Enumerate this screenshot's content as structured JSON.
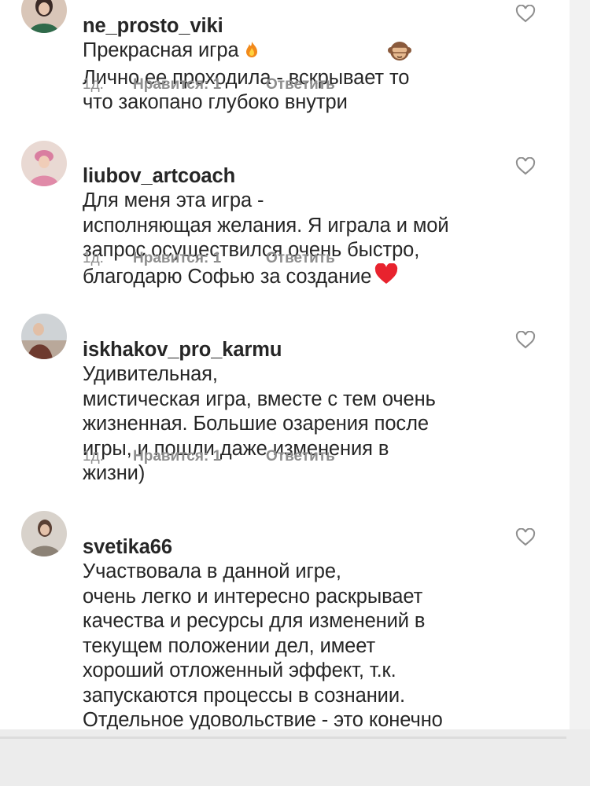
{
  "comments": [
    {
      "username": "ne_prosto_viki",
      "text": "Прекрасная игра",
      "text_continued": "Лично ее проходила - вскрывает то\nчто закопано глубоко внутри",
      "emojis": [
        "fire-emoji",
        "see-no-evil-monkey-emoji"
      ],
      "age": "1д.",
      "likes": "Нравится: 1",
      "reply": "Ответить"
    },
    {
      "username": "liubov_artcoach",
      "text": "Для меня эта игра -\nисполняющая желания. Я играла и мой\nзапрос осуществился очень быстро,\nблагодарю Софью за создание",
      "emojis": [
        "red-heart-emoji"
      ],
      "age": "1д.",
      "likes": "Нравится: 1",
      "reply": "Ответить"
    },
    {
      "username": "iskhakov_pro_karmu",
      "text": "Удивительная,\nмистическая игра, вместе с тем очень\nжизненная. Большие озарения после\nигры, и пошли даже изменения в\nжизни)",
      "age": "1д.",
      "likes": "Нравится: 1",
      "reply": "Ответить"
    },
    {
      "username": "svetika66",
      "text": "Участвовала в данной игре,\nочень легко и интересно раскрывает\nкачества и ресурсы для изменений в\nтекущем положении дел, имеет\nхороший отложенный эффект, т.к.\nзапускаются процессы в сознании.\nОтдельное удовольствие - это конечно\nисполнение: красиво и приятно\nвыполненный дизайн и материалы."
    }
  ],
  "colors": {
    "text": "#262626",
    "meta": "#8e8e8e",
    "heart_outline": "#8e8e8e",
    "emoji_heart": "#e8232e"
  }
}
